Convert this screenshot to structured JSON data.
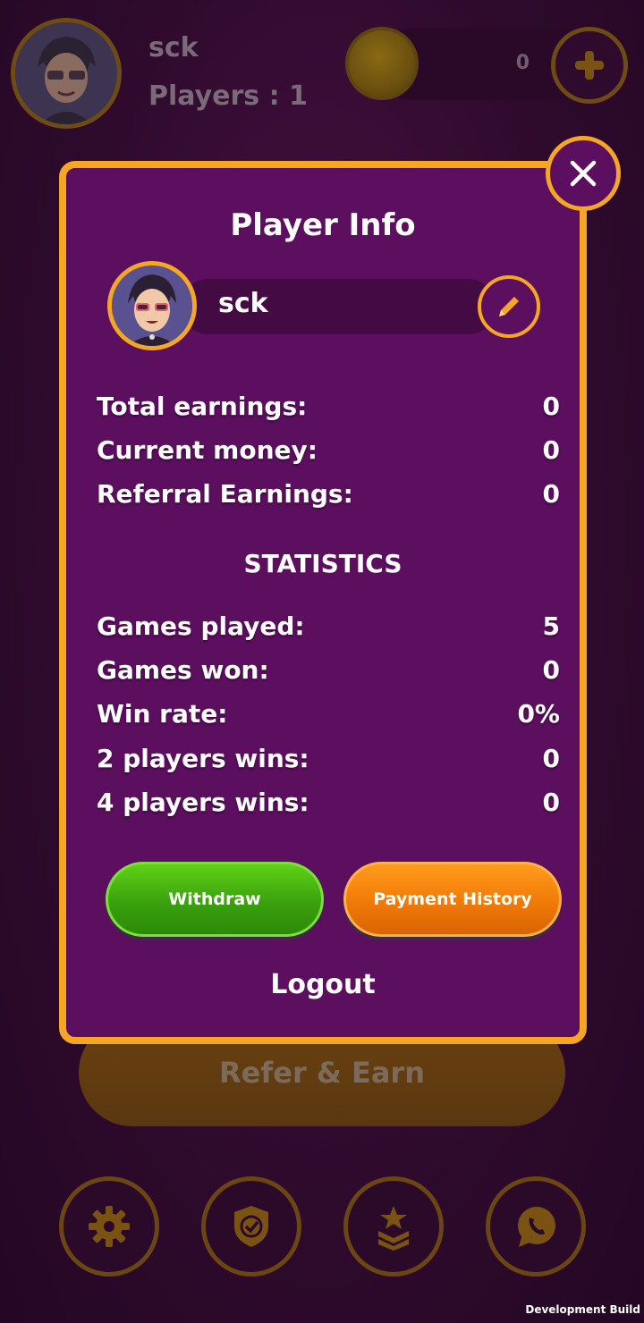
{
  "header": {
    "player_name": "sck",
    "players_label": "Players : 1",
    "coin_balance": "0",
    "avatar_icon": "avatar-icon",
    "coin_icon": "coin-icon",
    "add_icon": "plus-icon"
  },
  "modal": {
    "title": "Player Info",
    "player_name": "sck",
    "earnings": [
      {
        "label": "Total earnings:",
        "value": "0"
      },
      {
        "label": "Current money:",
        "value": "0"
      },
      {
        "label": "Referral Earnings:",
        "value": "0"
      }
    ],
    "statistics_title": "STATISTICS",
    "stats": [
      {
        "label": "Games played:",
        "value": "5"
      },
      {
        "label": "Games won:",
        "value": "0"
      },
      {
        "label": "Win rate:",
        "value": "0%"
      },
      {
        "label": "2 players wins:",
        "value": "0"
      },
      {
        "label": "4 players wins:",
        "value": "0"
      }
    ],
    "withdraw_label": "Withdraw",
    "payment_history_label": "Payment History",
    "logout_label": "Logout"
  },
  "refer_label": "Refer & Earn",
  "bottom_nav": [
    {
      "icon": "gear-icon"
    },
    {
      "icon": "shield-check-icon"
    },
    {
      "icon": "rank-badge-icon"
    },
    {
      "icon": "whatsapp-icon"
    }
  ],
  "dev_label": "Development Build",
  "colors": {
    "accent": "#f5a623",
    "modal_bg": "#5c0e5f",
    "withdraw": "#3aa10e",
    "history": "#f07a08"
  }
}
